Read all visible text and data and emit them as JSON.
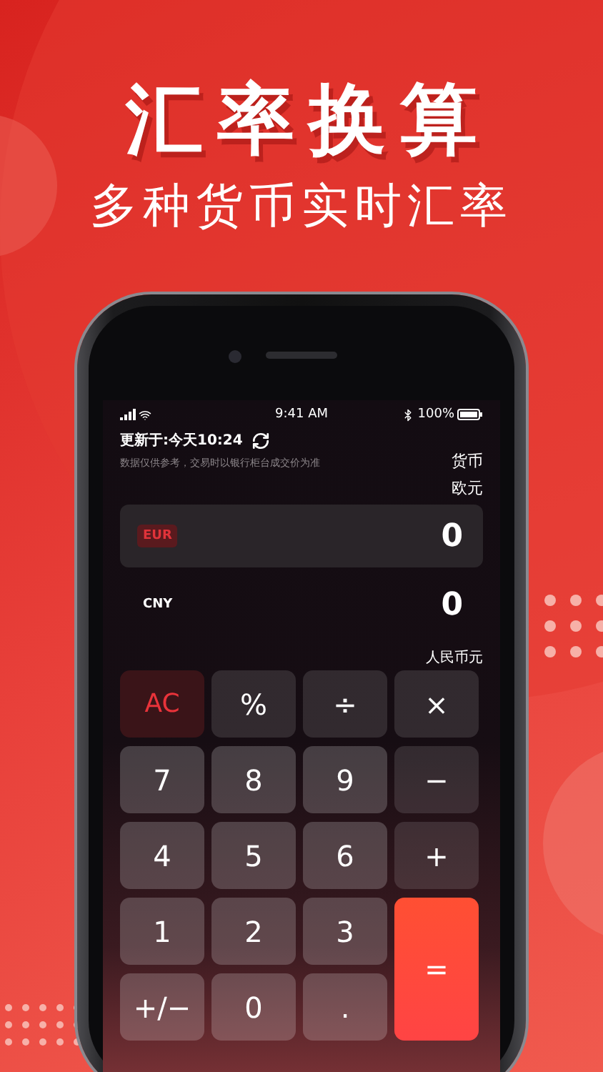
{
  "headline": {
    "title": "汇率换算",
    "subtitle": "多种货币实时汇率"
  },
  "status_bar": {
    "time": "9:41 AM",
    "battery": "100%"
  },
  "update": {
    "label": "更新于:今天10:24",
    "note": "数据仅供参考，交易时以银行柜台成交价为准",
    "currency_label": "货币"
  },
  "rows": [
    {
      "currency_name": "欧元",
      "code": "EUR",
      "value": "0",
      "selected": true
    },
    {
      "currency_name": "人民币元",
      "code": "CNY",
      "value": "0",
      "selected": false
    }
  ],
  "keys": [
    {
      "label": "AC",
      "kind": "clear"
    },
    {
      "label": "%",
      "kind": "operator"
    },
    {
      "label": "÷",
      "kind": "operator"
    },
    {
      "label": "×",
      "kind": "operator"
    },
    {
      "label": "7",
      "kind": "digit"
    },
    {
      "label": "8",
      "kind": "digit"
    },
    {
      "label": "9",
      "kind": "digit"
    },
    {
      "label": "−",
      "kind": "operator"
    },
    {
      "label": "4",
      "kind": "digit"
    },
    {
      "label": "5",
      "kind": "digit"
    },
    {
      "label": "6",
      "kind": "digit"
    },
    {
      "label": "+",
      "kind": "operator"
    },
    {
      "label": "1",
      "kind": "digit"
    },
    {
      "label": "2",
      "kind": "digit"
    },
    {
      "label": "3",
      "kind": "digit"
    },
    {
      "label": "=",
      "kind": "equals"
    },
    {
      "label": "+/−",
      "kind": "digit"
    },
    {
      "label": "0",
      "kind": "digit"
    },
    {
      "label": ".",
      "kind": "digit"
    }
  ]
}
